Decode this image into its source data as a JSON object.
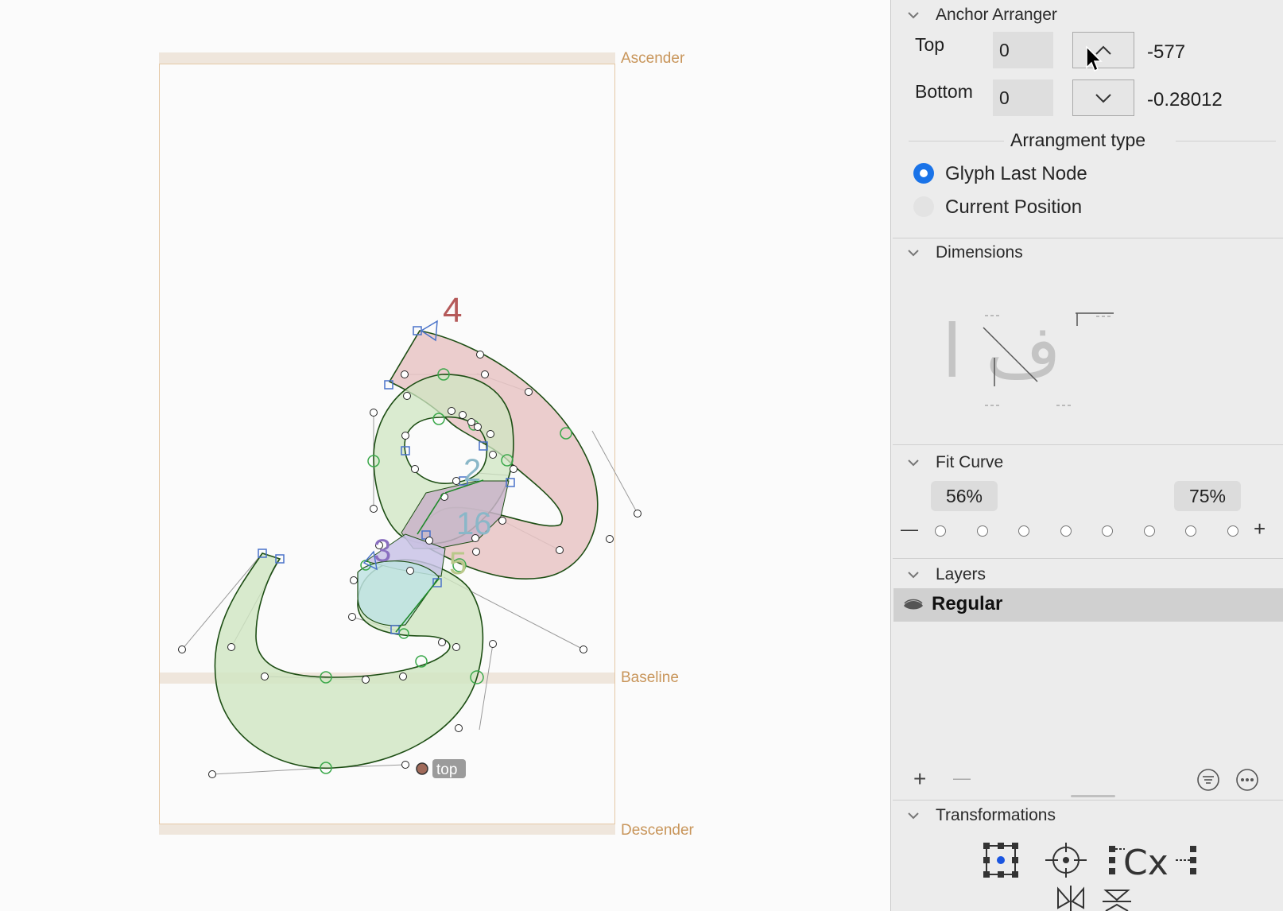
{
  "canvas": {
    "metrics": {
      "ascender": "Ascender",
      "baseline": "Baseline",
      "descender": "Descender"
    },
    "node_labels": [
      "4",
      "2",
      "16",
      "3",
      "5"
    ],
    "anchor_label": "top",
    "colors": {
      "metric": "#c8955a",
      "fill_green": "#cfe6c2",
      "fill_red": "#e8c4c4",
      "fill_cyan": "#bfe3e3",
      "fill_purple": "#c9c3e6",
      "outline": "#1d4e14"
    }
  },
  "sidebar": {
    "anchor_arranger": {
      "title": "Anchor Arranger",
      "top_label": "Top",
      "top_value": "0",
      "top_readout": "-577",
      "bottom_label": "Bottom",
      "bottom_value": "0",
      "bottom_readout": "-0.28012",
      "arrangement_title": "Arrangment type",
      "options": [
        {
          "label": "Glyph Last Node",
          "selected": true
        },
        {
          "label": "Current Position",
          "selected": false
        }
      ]
    },
    "dimensions": {
      "title": "Dimensions",
      "preview_glyphs": "ف ا"
    },
    "fit_curve": {
      "title": "Fit Curve",
      "left_pct": "56%",
      "right_pct": "75%",
      "minus": "—",
      "plus": "+"
    },
    "layers": {
      "title": "Layers",
      "items": [
        {
          "name": "Regular",
          "selected": true
        }
      ],
      "add": "+",
      "remove": "—"
    },
    "transformations": {
      "title": "Transformations",
      "icons": [
        "bounding-box-icon",
        "crosshair-icon",
        "metrics-cx-icon",
        "mirror-horizontal-icon",
        "mirror-vertical-icon"
      ]
    }
  }
}
